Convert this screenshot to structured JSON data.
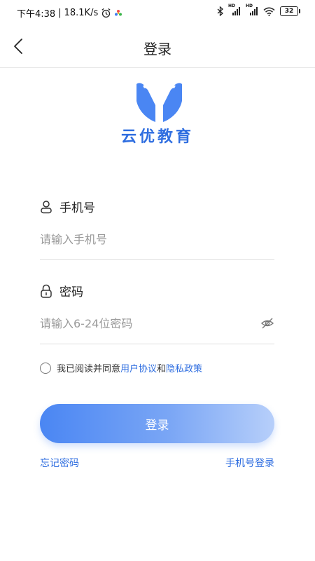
{
  "status_bar": {
    "time": "下午4:38",
    "net_speed": "18.1K/s",
    "signal1_label": "HD",
    "signal2_label": "HD",
    "battery": "32"
  },
  "navbar": {
    "title": "登录"
  },
  "brand": {
    "name": "云优教育"
  },
  "form": {
    "phone_label": "手机号",
    "phone_placeholder": "请输入手机号",
    "password_label": "密码",
    "password_placeholder": "请输入6-24位密码"
  },
  "agreement": {
    "prefix": "我已阅读并同意",
    "user_agreement": "用户协议",
    "and": "和",
    "privacy_policy": "隐私政策"
  },
  "login_button": "登录",
  "links": {
    "forgot_password": "忘记密码",
    "phone_login": "手机号登录"
  },
  "colors": {
    "accent": "#2f6ee0",
    "button_gradient_start": "#4a86f3",
    "button_gradient_end": "#b7cffa"
  },
  "icons": [
    "back-arrow-icon",
    "alarm-icon",
    "app-icon",
    "bluetooth-icon",
    "signal-icon",
    "wifi-icon",
    "battery-icon",
    "user-icon",
    "lock-icon",
    "eye-closed-icon",
    "radio-icon"
  ]
}
